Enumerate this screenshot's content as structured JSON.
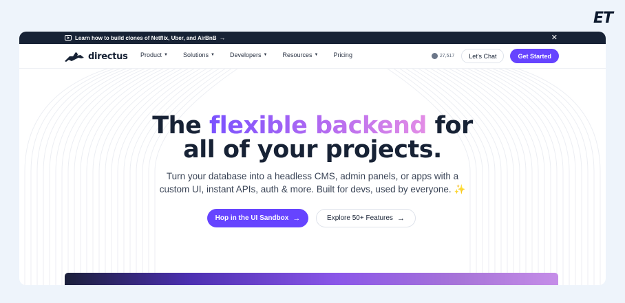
{
  "corner_logo": "ET",
  "announcement": {
    "text": "Learn how to build clones of Netflix, Uber, and AirBnB",
    "arrow": "→",
    "close": "✕"
  },
  "nav": {
    "brand": "directus",
    "menu": [
      {
        "label": "Product",
        "has_dropdown": true
      },
      {
        "label": "Solutions",
        "has_dropdown": true
      },
      {
        "label": "Developers",
        "has_dropdown": true
      },
      {
        "label": "Resources",
        "has_dropdown": true
      },
      {
        "label": "Pricing",
        "has_dropdown": false
      }
    ],
    "github_stars": "27,517",
    "chat_label": "Let's Chat",
    "start_label": "Get Started"
  },
  "hero": {
    "headline_pre": "The",
    "headline_highlight": "flexible backend",
    "headline_post": "for",
    "headline_line2": "all of your projects.",
    "sub_line1": "Turn your database into a headless CMS, admin panels, or apps with a",
    "sub_line2": "custom UI, instant APIs, auth & more. Built for devs, used by everyone.",
    "sparkle": "✨",
    "cta_primary": "Hop in the UI Sandbox",
    "cta_secondary": "Explore 50+ Features",
    "cta_arrow": "→"
  },
  "colors": {
    "accent": "#6644ff",
    "dark": "#172235",
    "page_bg": "#eef4fb"
  }
}
